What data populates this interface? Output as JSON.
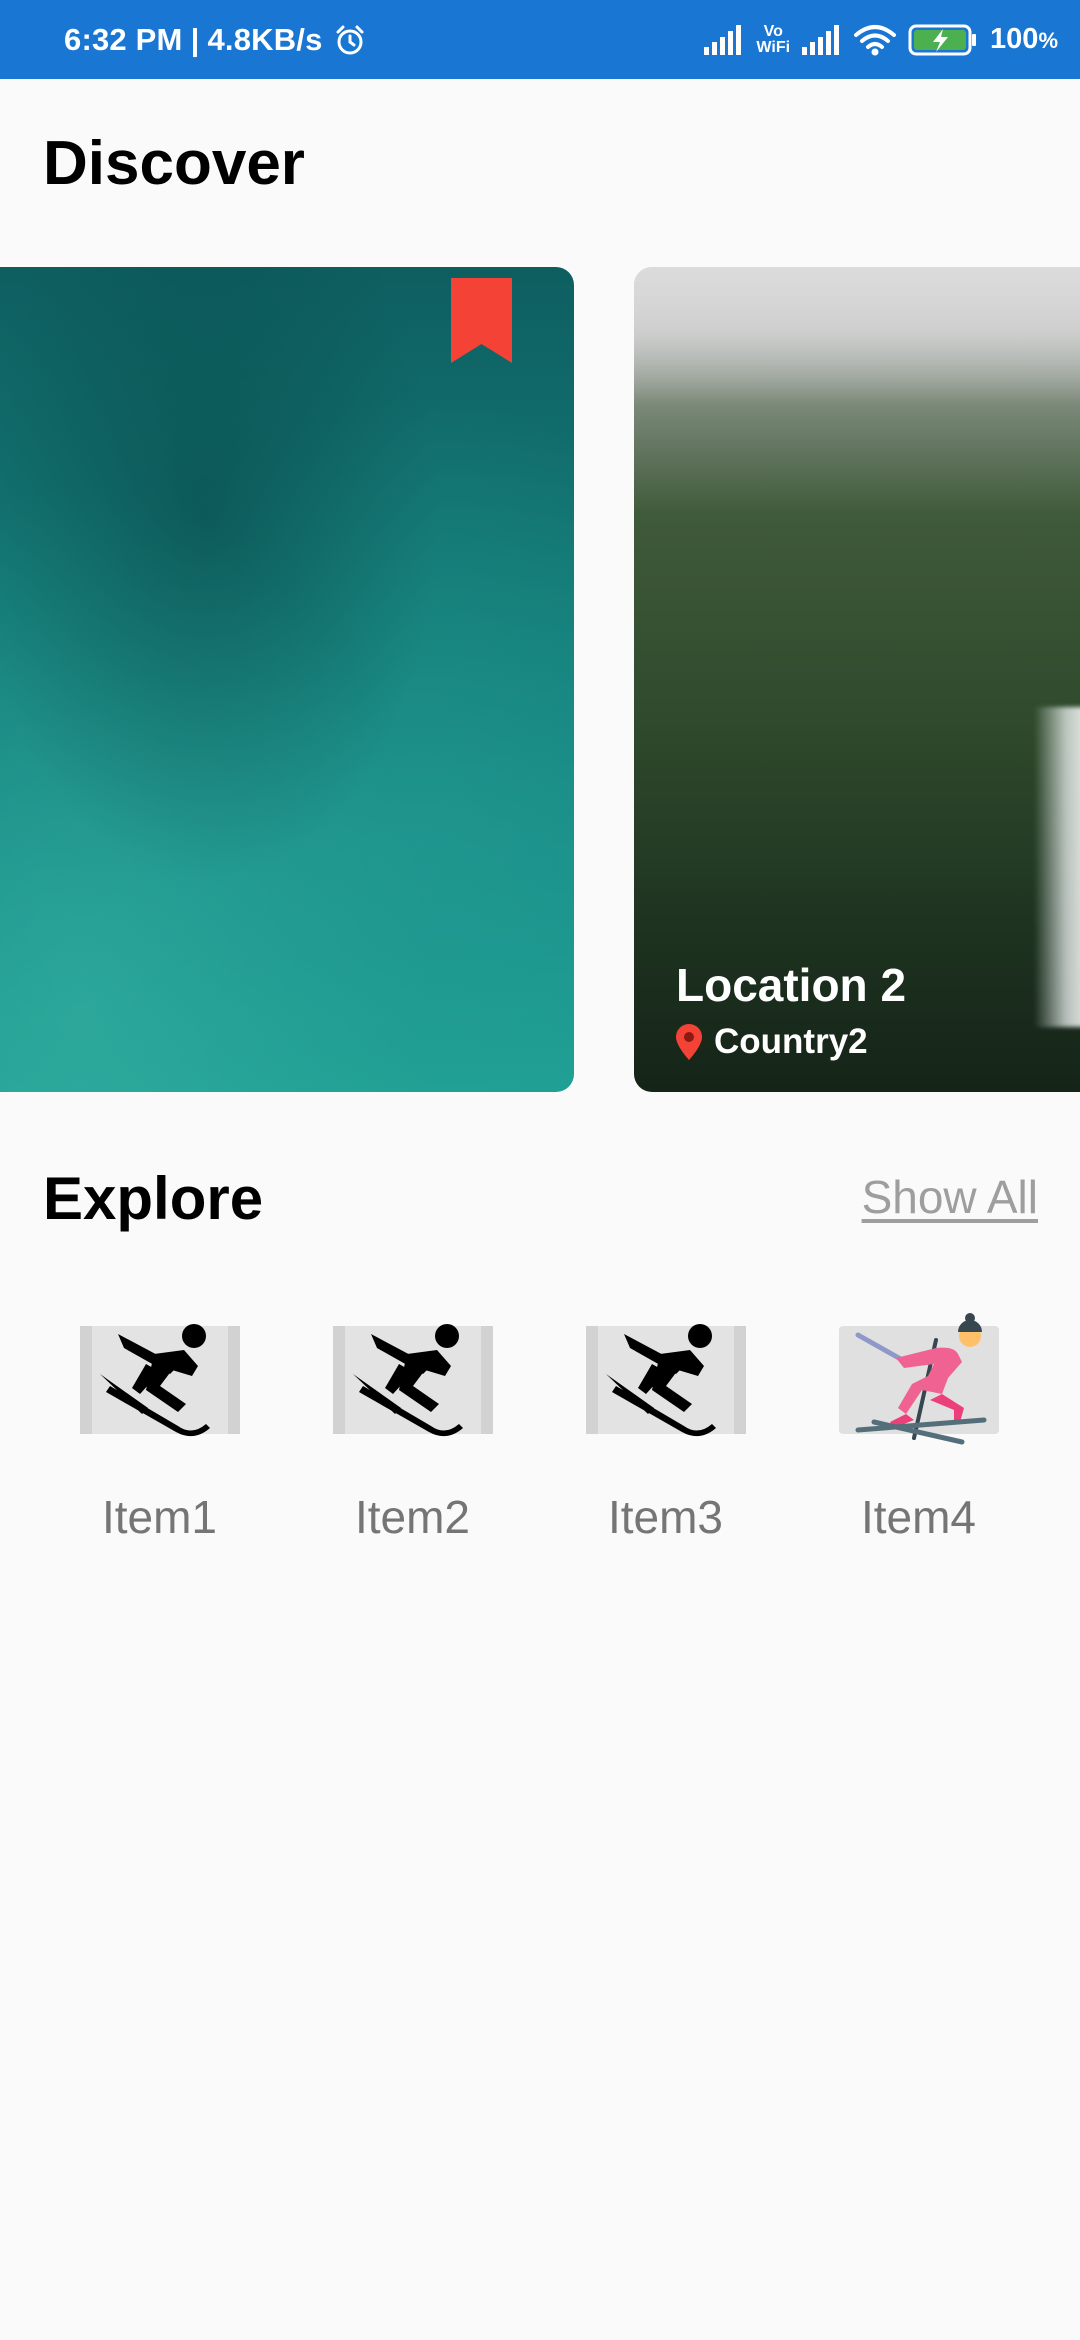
{
  "status_bar": {
    "time": "6:32 PM",
    "separator": "|",
    "speed": "4.8KB/s",
    "vowifi_top": "Vo",
    "vowifi_bottom": "WiFi",
    "battery": "100",
    "battery_unit": "%",
    "background_color": "#1976D2"
  },
  "discover": {
    "title": "Discover",
    "cards": [
      {
        "title": "",
        "country": "",
        "bookmarked": true,
        "bookmark_color": "#F44336"
      },
      {
        "title": "Location 2",
        "country": "Country2",
        "pin_color": "#F44336"
      }
    ]
  },
  "explore": {
    "title": "Explore",
    "show_all": "Show All",
    "items": [
      {
        "label": "Item1",
        "icon": "skier-icon"
      },
      {
        "label": "Item2",
        "icon": "skier-icon"
      },
      {
        "label": "Item3",
        "icon": "skier-icon"
      },
      {
        "label": "Item4",
        "icon": "cross-country-skier-icon"
      }
    ]
  }
}
